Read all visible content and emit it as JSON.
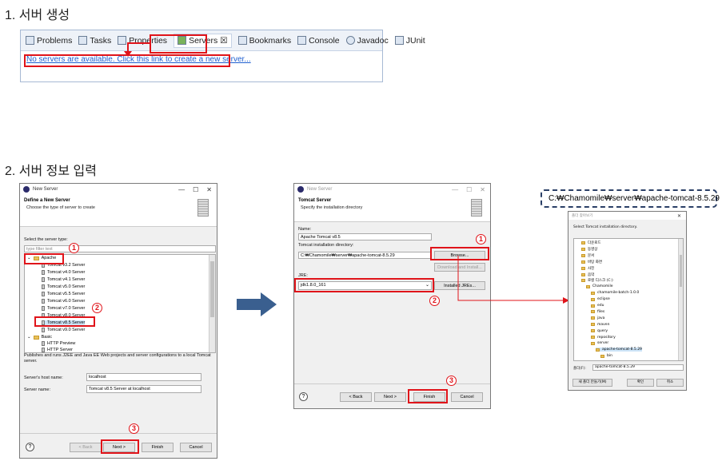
{
  "section1": {
    "heading": "1. 서버 생성"
  },
  "section2": {
    "heading": "2. 서버 정보 입력"
  },
  "tabs": [
    {
      "label": "Problems",
      "icon": "problems-icon"
    },
    {
      "label": "Tasks",
      "icon": "tasks-icon"
    },
    {
      "label": "Properties",
      "icon": "properties-icon"
    },
    {
      "label": "Servers ☒",
      "icon": "servers-icon"
    },
    {
      "label": "Bookmarks",
      "icon": "bookmarks-icon"
    },
    {
      "label": "Console",
      "icon": "console-icon"
    },
    {
      "label": "Javadoc",
      "icon": "javadoc-icon"
    },
    {
      "label": "JUnit",
      "icon": "junit-icon"
    }
  ],
  "servers_view": {
    "empty_link": "No servers are available. Click this link to create a new server..."
  },
  "dialog1": {
    "window_title": "New Server",
    "header_title": "Define a New Server",
    "header_subtitle": "Choose the type of server to create",
    "server_type_label": "Select the server type:",
    "filter_placeholder": "type filter text",
    "tree": {
      "apache": "Apache",
      "servers": [
        "Tomcat v3.2 Server",
        "Tomcat v4.0 Server",
        "Tomcat v4.1 Server",
        "Tomcat v5.0 Server",
        "Tomcat v5.5 Server",
        "Tomcat v6.0 Server",
        "Tomcat v7.0 Server",
        "Tomcat v8.0 Server",
        "Tomcat v8.5 Server",
        "Tomcat v9.0 Server"
      ],
      "basic": "Basic",
      "basic_items": [
        "HTTP Preview",
        "HTTP Server"
      ]
    },
    "description": "Publishes and runs J2EE and Java EE Web projects and server configurations to a local Tomcat server.",
    "host_label": "Server's host name:",
    "host_value": "localhost",
    "name_label": "Server name:",
    "name_value": "Tomcat v8.5 Server at localhost",
    "buttons": {
      "back": "< Back",
      "next": "Next >",
      "finish": "Finish",
      "cancel": "Cancel"
    }
  },
  "dialog2": {
    "window_title": "New Server",
    "header_title": "Tomcat Server",
    "header_subtitle": "Specify the installation directory",
    "name_label": "Name:",
    "name_value": "Apache Tomcat v8.5",
    "dir_label": "Tomcat installation directory:",
    "dir_value": "C:₩Chamomile₩server₩apache-tomcat-8.5.29",
    "browse": "Browse...",
    "download": "Download and Install...",
    "jre_label": "JRE:",
    "jre_value": "jdk1.8.0_161",
    "installed_jres": "Installed JREs...",
    "buttons": {
      "back": "< Back",
      "next": "Next >",
      "finish": "Finish",
      "cancel": "Cancel"
    }
  },
  "callout": {
    "path": "C:₩Chamomile₩server₩apache-tomcat-8.5.29"
  },
  "folder_dialog": {
    "window_title": "폴더 찾아보기",
    "instruction": "Select Tomcat installation directory.",
    "items": [
      {
        "label": "다운로드",
        "depth": 1
      },
      {
        "label": "동영상",
        "depth": 1
      },
      {
        "label": "문서",
        "depth": 1
      },
      {
        "label": "바탕 화면",
        "depth": 1
      },
      {
        "label": "사진",
        "depth": 1
      },
      {
        "label": "음악",
        "depth": 1
      },
      {
        "label": "로컬 디스크 (C:)",
        "depth": 1
      },
      {
        "label": "Chamomile",
        "depth": 2
      },
      {
        "label": "chamomile-batch-1.0.0",
        "depth": 3
      },
      {
        "label": "eclipse",
        "depth": 3
      },
      {
        "label": "edu",
        "depth": 3
      },
      {
        "label": "files",
        "depth": 3
      },
      {
        "label": "java",
        "depth": 3
      },
      {
        "label": "maven",
        "depth": 3
      },
      {
        "label": "query",
        "depth": 3
      },
      {
        "label": "repository",
        "depth": 3
      },
      {
        "label": "server",
        "depth": 3
      },
      {
        "label": "apache-tomcat-8.5.29",
        "depth": 4
      },
      {
        "label": "bin",
        "depth": 5
      }
    ],
    "folder_label": "폴더(F):",
    "folder_value": "apache-tomcat-8.5.29",
    "new_folder": "새 폴더 만들기(M)",
    "ok": "확인",
    "cancel": "취소"
  },
  "markers": {
    "one": "1",
    "two": "2",
    "three": "3"
  },
  "colors": {
    "highlight": "#e0141a",
    "arrow": "#3a5f8f",
    "link": "#2060d0"
  }
}
